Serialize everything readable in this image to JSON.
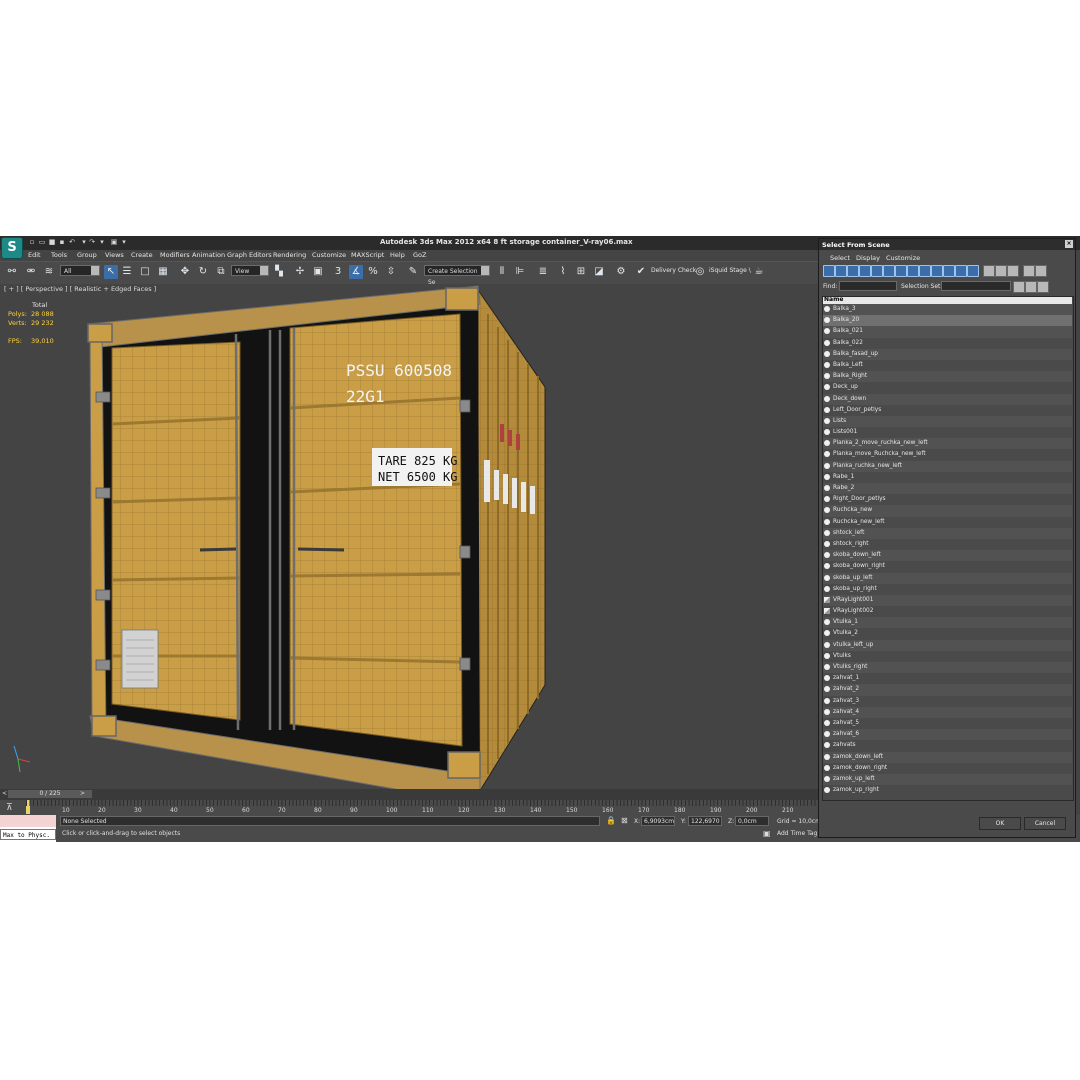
{
  "window": {
    "title": "Autodesk 3ds Max  2012 x64      8 ft storage container_V-ray06.max",
    "logo_glyph": "S"
  },
  "menubar": [
    "Edit",
    "Tools",
    "Group",
    "Views",
    "Create",
    "Modifiers",
    "Animation",
    "Graph Editors",
    "Rendering",
    "Customize",
    "MAXScript",
    "Help",
    "GoZ"
  ],
  "toolbar": {
    "filter_value": "All",
    "refcoord_value": "View",
    "snap_value": "3",
    "angle_snap_label": "%",
    "named_selection_placeholder": "Create Selection Se",
    "delivery_check_label": "Delivery Check",
    "stage_label": "iSquid Stage \\"
  },
  "viewport": {
    "label": "[ + ] [ Perspective ] [ Realistic + Edged Faces ]",
    "stats": {
      "total_header": "Total",
      "polys_label": "Polys:",
      "polys_value": "28 088",
      "verts_label": "Verts:",
      "verts_value": "29 232",
      "fps_label": "FPS:",
      "fps_value": "39,010"
    },
    "container_text": {
      "code_line1": "PSSU 600508",
      "code_line2": "22G1",
      "tare": "TARE 825 KG",
      "net": "NET 6500 KG"
    },
    "colors": {
      "container": "#c99e46",
      "frame": "#151515",
      "background": "#444444"
    }
  },
  "timeline": {
    "slider_label": "0 / 225",
    "ticks": [
      "10",
      "20",
      "30",
      "40",
      "50",
      "60",
      "70",
      "80",
      "90",
      "100",
      "110",
      "120",
      "130",
      "140",
      "150",
      "160",
      "170",
      "180",
      "190",
      "200",
      "210"
    ]
  },
  "statusbar": {
    "selection": "None Selected",
    "prompt": "Click or click-and-drag to select objects",
    "x_label": "X:",
    "x_value": "6,9093cm",
    "y_label": "Y:",
    "y_value": "122,6970",
    "z_label": "Z:",
    "z_value": "0,0cm",
    "grid": "Grid = 10,0cm",
    "add_time_tag": "Add Time Tag",
    "maxscript_label": "Max to Physc."
  },
  "dialog": {
    "title": "Select From Scene",
    "menu": [
      "Select",
      "Display",
      "Customize"
    ],
    "find_label": "Find:",
    "selection_set_label": "Selection Set:",
    "column_header": "Name",
    "ok_label": "OK",
    "cancel_label": "Cancel",
    "selected_item": "Balka_20",
    "items": [
      {
        "name": "Balka_3",
        "kind": "object"
      },
      {
        "name": "Balka_20",
        "kind": "object"
      },
      {
        "name": "Balka_021",
        "kind": "object"
      },
      {
        "name": "Balka_022",
        "kind": "object"
      },
      {
        "name": "Balka_fasad_up",
        "kind": "object"
      },
      {
        "name": "Balka_Left",
        "kind": "object"
      },
      {
        "name": "Balka_Right",
        "kind": "object"
      },
      {
        "name": "Deck_up",
        "kind": "object"
      },
      {
        "name": "Deck_down",
        "kind": "object"
      },
      {
        "name": "Left_Door_petlys",
        "kind": "object"
      },
      {
        "name": "Lists",
        "kind": "object"
      },
      {
        "name": "Lists001",
        "kind": "object"
      },
      {
        "name": "Planka_2_move_ruchka_new_left",
        "kind": "object"
      },
      {
        "name": "Planka_move_Ruchcka_new_left",
        "kind": "object"
      },
      {
        "name": "Planka_ruchka_new_left",
        "kind": "object"
      },
      {
        "name": "Rabe_1",
        "kind": "object"
      },
      {
        "name": "Rabe_2",
        "kind": "object"
      },
      {
        "name": "Right_Door_petlys",
        "kind": "object"
      },
      {
        "name": "Ruchcka_new",
        "kind": "object"
      },
      {
        "name": "Ruchcka_new_left",
        "kind": "object"
      },
      {
        "name": "shtock_left",
        "kind": "object"
      },
      {
        "name": "shtock_right",
        "kind": "object"
      },
      {
        "name": "skoba_down_left",
        "kind": "object"
      },
      {
        "name": "skoba_down_right",
        "kind": "object"
      },
      {
        "name": "skoba_up_left",
        "kind": "object"
      },
      {
        "name": "skoba_up_right",
        "kind": "object"
      },
      {
        "name": "VRayLight001",
        "kind": "light"
      },
      {
        "name": "VRayLight002",
        "kind": "light"
      },
      {
        "name": "Vtulka_1",
        "kind": "object"
      },
      {
        "name": "Vtulka_2",
        "kind": "object"
      },
      {
        "name": "vtulka_left_up",
        "kind": "object"
      },
      {
        "name": "Vtulks",
        "kind": "object"
      },
      {
        "name": "Vtulks_right",
        "kind": "object"
      },
      {
        "name": "zahvat_1",
        "kind": "object"
      },
      {
        "name": "zahvat_2",
        "kind": "object"
      },
      {
        "name": "zahvat_3",
        "kind": "object"
      },
      {
        "name": "zahvat_4",
        "kind": "object"
      },
      {
        "name": "zahvat_5",
        "kind": "object"
      },
      {
        "name": "zahvat_6",
        "kind": "object"
      },
      {
        "name": "zahvats",
        "kind": "object"
      },
      {
        "name": "zamok_down_left",
        "kind": "object"
      },
      {
        "name": "zamok_down_right",
        "kind": "object"
      },
      {
        "name": "zamok_up_left",
        "kind": "object"
      },
      {
        "name": "zamok_up_right",
        "kind": "object"
      }
    ]
  }
}
